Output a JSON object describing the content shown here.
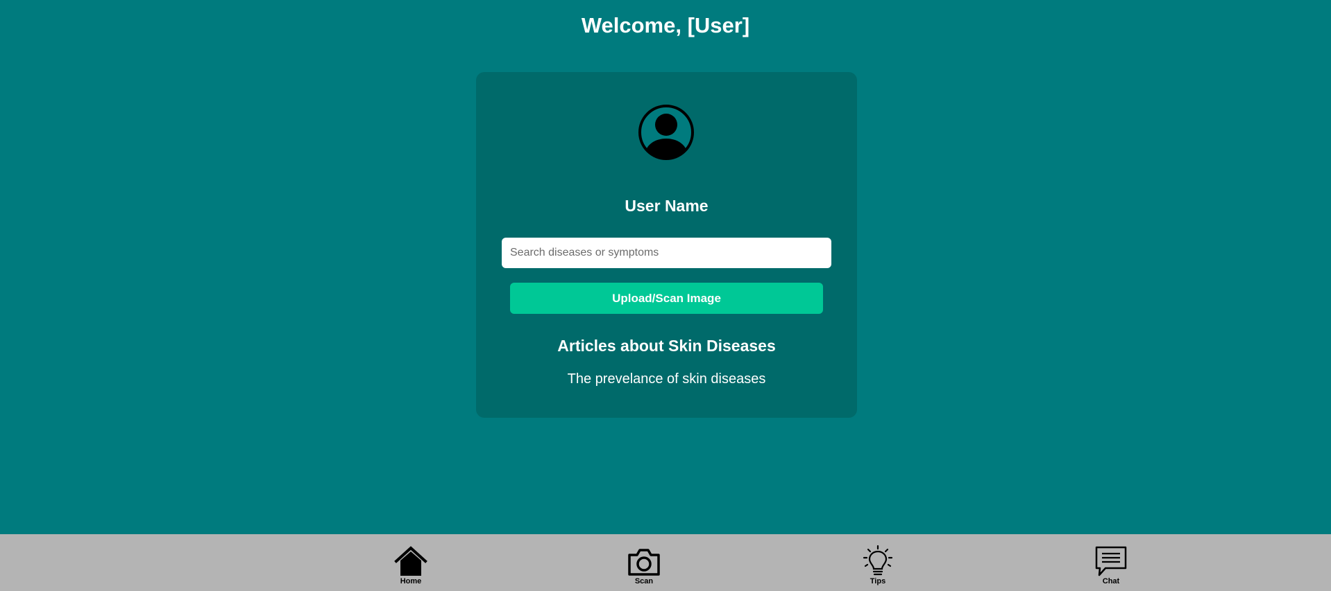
{
  "header": {
    "welcome": "Welcome, [User]"
  },
  "profile": {
    "avatar_icon": "user-circle-icon",
    "user_name": "User Name"
  },
  "search": {
    "placeholder": "Search diseases or symptoms",
    "value": ""
  },
  "actions": {
    "upload_label": "Upload/Scan Image"
  },
  "articles": {
    "title": "Articles about Skin Diseases",
    "items": [
      {
        "label": "The prevelance of skin diseases"
      }
    ]
  },
  "bottom_nav": {
    "items": [
      {
        "label": "Home",
        "icon": "home-icon"
      },
      {
        "label": "Scan",
        "icon": "camera-icon"
      },
      {
        "label": "Tips",
        "icon": "lightbulb-icon"
      },
      {
        "label": "Chat",
        "icon": "chat-icon"
      }
    ]
  },
  "colors": {
    "background": "#007b7e",
    "card": "#006a6a",
    "accent_button": "#00c896",
    "nav_bar": "#b4b4b4"
  }
}
